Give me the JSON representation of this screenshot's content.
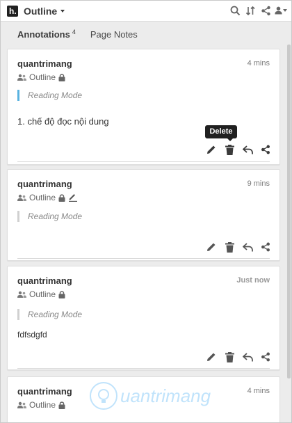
{
  "header": {
    "group_name": "Outline",
    "icons": [
      "hypothesis-logo-icon",
      "search-icon",
      "sort-icon",
      "share-icon",
      "user-icon"
    ]
  },
  "tabs": [
    {
      "label": "Annotations",
      "count": "4",
      "active": true
    },
    {
      "label": "Page Notes",
      "active": false
    }
  ],
  "tooltip": "Delete",
  "cards": [
    {
      "user": "quantrimang",
      "time": "4 mins",
      "group": "Outline",
      "quote": "Reading Mode",
      "text": "1. chế độ đọc nội dung"
    },
    {
      "user": "quantrimang",
      "time": "9 mins",
      "group": "Outline",
      "quote": "Reading Mode",
      "text": ""
    },
    {
      "user": "quantrimang",
      "time": "Just now",
      "group": "Outline",
      "quote": "Reading Mode",
      "text": "fdfsdgfd"
    },
    {
      "user": "quantrimang",
      "time": "4 mins",
      "group": "Outline"
    }
  ],
  "watermark": "uantrimang",
  "colors": {
    "accent_blue": "#58b2e0",
    "tooltip_bg": "#202020",
    "background": "#ececec"
  }
}
